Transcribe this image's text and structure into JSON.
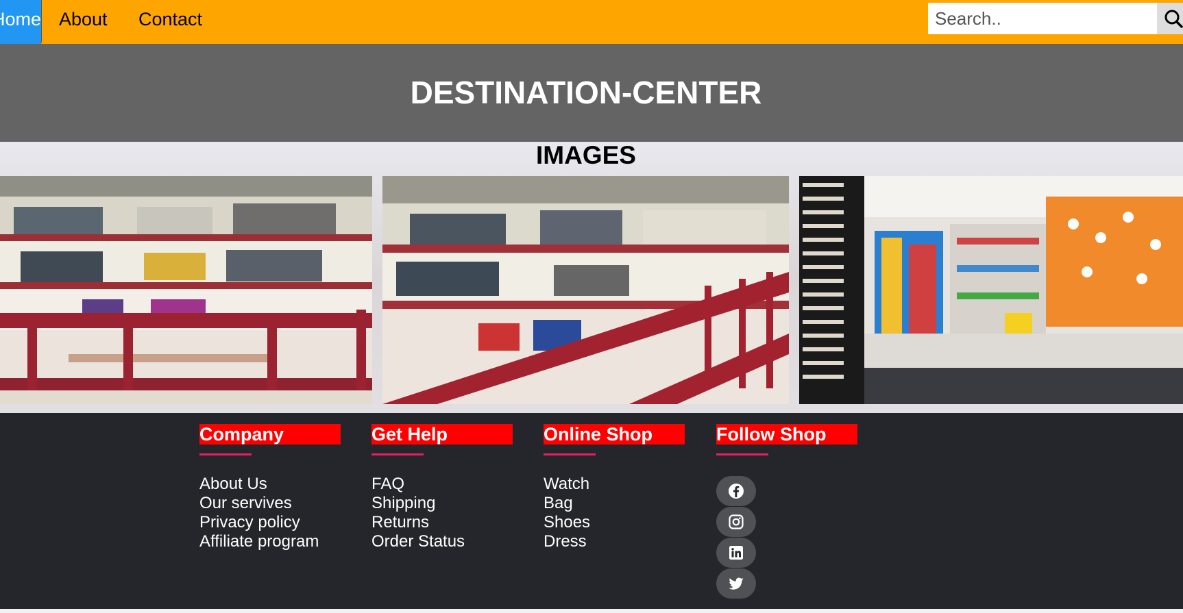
{
  "nav": {
    "home_label": "Home",
    "about_label": "About",
    "contact_label": "Contact",
    "search_placeholder": "Search..",
    "bg_color": "#ffa500",
    "active_color": "#2196f3"
  },
  "header": {
    "title": "DESTINATION-CENTER"
  },
  "images_section": {
    "title": "IMAGES",
    "photos": [
      {
        "alt": "Mall atrium with red railings"
      },
      {
        "alt": "Mall atrium balcony view"
      },
      {
        "alt": "Toy and sports store front"
      }
    ]
  },
  "footer": {
    "heading_color": "#ff0000",
    "columns": [
      {
        "heading": "Company",
        "links": [
          "About Us",
          "Our servives",
          "Privacy policy",
          "Affiliate program"
        ]
      },
      {
        "heading": "Get Help",
        "links": [
          "FAQ",
          "Shipping",
          "Returns",
          "Order Status"
        ]
      },
      {
        "heading": "Online Shop",
        "links": [
          "Watch",
          "Bag",
          "Shoes",
          "Dress"
        ]
      },
      {
        "heading": "Follow Shop",
        "social": [
          "facebook-icon",
          "instagram-icon",
          "linkedin-icon",
          "twitter-icon"
        ]
      }
    ]
  }
}
